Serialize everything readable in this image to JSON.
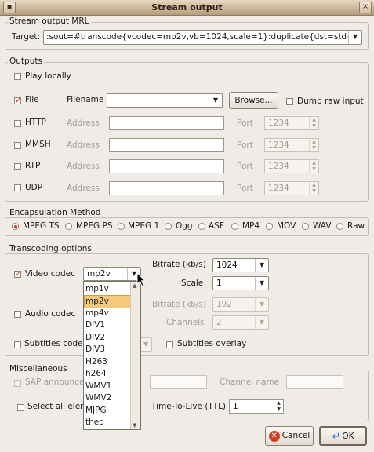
{
  "window": {
    "title": "Stream output",
    "close_glyph": "×"
  },
  "mrl": {
    "group_label": "Stream output MRL",
    "target_label": "Target:",
    "target_value": ":sout=#transcode{vcodec=mp2v,vb=1024,scale=1}:duplicate{dst=std{access"
  },
  "outputs": {
    "group_label": "Outputs",
    "play_locally": "Play locally",
    "file": {
      "label": "File",
      "filename_label": "Filename",
      "filename_value": "",
      "browse": "Browse...",
      "dump_raw": "Dump raw input"
    },
    "address_label": "Address",
    "port_label": "Port",
    "rows": [
      {
        "label": "HTTP",
        "port": "1234"
      },
      {
        "label": "MMSH",
        "port": "1234"
      },
      {
        "label": "RTP",
        "port": "1234"
      },
      {
        "label": "UDP",
        "port": "1234"
      }
    ]
  },
  "encapsulation": {
    "group_label": "Encapsulation Method",
    "options": [
      "MPEG TS",
      "MPEG PS",
      "MPEG 1",
      "Ogg",
      "ASF",
      "MP4",
      "MOV",
      "WAV",
      "Raw"
    ],
    "selected": "MPEG TS"
  },
  "transcoding": {
    "group_label": "Transcoding options",
    "video_codec_label": "Video codec",
    "video_codec_value": "mp2v",
    "video_bitrate_label": "Bitrate (kb/s)",
    "video_bitrate_value": "1024",
    "scale_label": "Scale",
    "scale_value": "1",
    "audio_codec_label": "Audio codec",
    "audio_bitrate_label": "Bitrate (kb/s)",
    "audio_bitrate_value": "192",
    "channels_label": "Channels",
    "channels_value": "2",
    "subtitles_codec_label": "Subtitles codec",
    "subtitles_overlay_label": "Subtitles overlay"
  },
  "codec_dropdown": {
    "items": [
      "mp1v",
      "mp2v",
      "mp4v",
      "DIV1",
      "DIV2",
      "DIV3",
      "H263",
      "h264",
      "WMV1",
      "WMV2",
      "MJPG",
      "theo"
    ],
    "selected": "mp2v"
  },
  "misc": {
    "group_label": "Miscellaneous",
    "sap_label": "SAP announce",
    "channel_name_label": "Channel name",
    "select_all_label": "Select all elem",
    "ttl_label": "Time-To-Live (TTL)",
    "ttl_value": "1"
  },
  "buttons": {
    "cancel": "Cancel",
    "ok": "OK"
  },
  "colors": {
    "accent_check": "#c4361c",
    "selection": "#f5c97a",
    "background": "#efebe7"
  }
}
